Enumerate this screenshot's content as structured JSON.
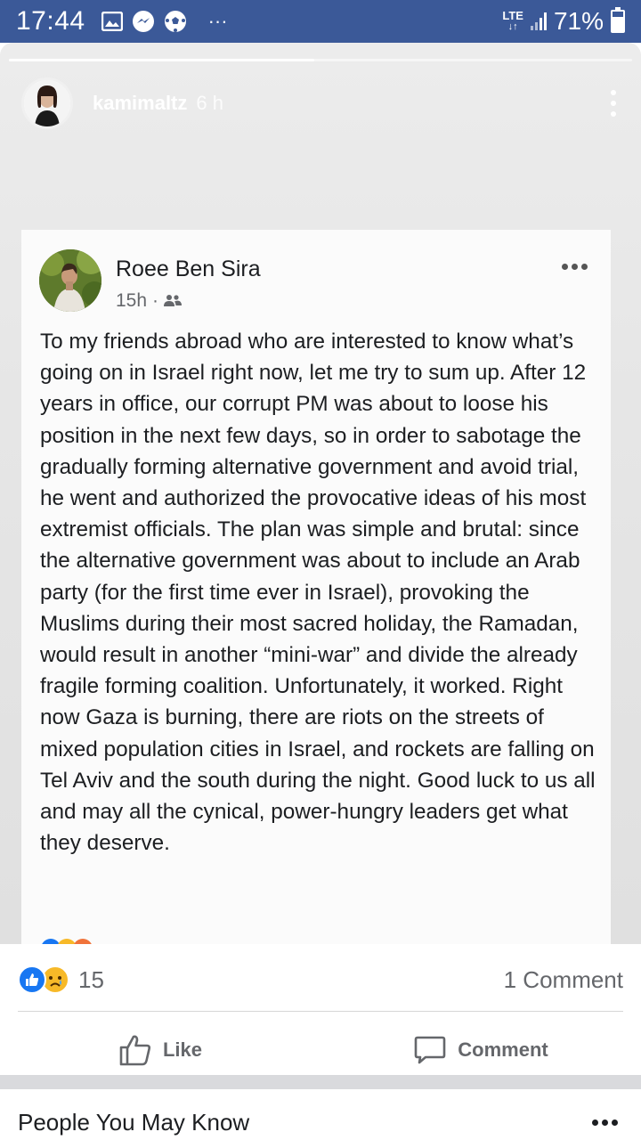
{
  "status_bar": {
    "time": "17:44",
    "more_indicator": "···",
    "network": "LTE",
    "battery_text": "71%",
    "battery_level": 0.71,
    "icons": [
      "gallery-icon",
      "messenger-icon",
      "soccer-ball-icon",
      "signal-icon",
      "battery-icon"
    ]
  },
  "story": {
    "progress": 0.49,
    "username": "kamimaltz",
    "time_ago": "6 h"
  },
  "post": {
    "author": "Roee Ben Sira",
    "time_ago": "15h",
    "separator": "·",
    "audience_icon": "friends-icon",
    "text": "To my friends abroad who are interested to know what’s going on in Israel right now, let me try to sum up. After 12 years in office, our corrupt PM was about to loose his position in the next few days, so in order to sabotage the gradually forming alternative government and avoid trial, he went and authorized the provocative ideas of his most extremist officials. The plan was simple and brutal: since the alternative government was about to include an Arab party (for the first time ever in Israel), provoking the Muslims during their most sacred holiday, the Ramadan, would result in another “mini-war” and divide the already fragile forming coalition. Unfortunately, it worked. Right now Gaza is burning, there are riots on the streets of mixed population cities in Israel, and rockets are falling on Tel Aviv and the south during the night. Good luck to us all and may all the cynical, power-hungry leaders get what they deserve."
  },
  "engagement": {
    "reaction_count": "15",
    "comment_count": "1 Comment",
    "reactions": [
      "like-reaction-icon",
      "sad-reaction-icon"
    ],
    "like_label": "Like",
    "comment_label": "Comment"
  },
  "pymk": {
    "title": "People You May Know"
  },
  "colors": {
    "status_bar": "#3b5998",
    "facebook_blue": "#1877f2",
    "sad_yellow": "#f7b928",
    "secondary_text": "#65676b"
  }
}
